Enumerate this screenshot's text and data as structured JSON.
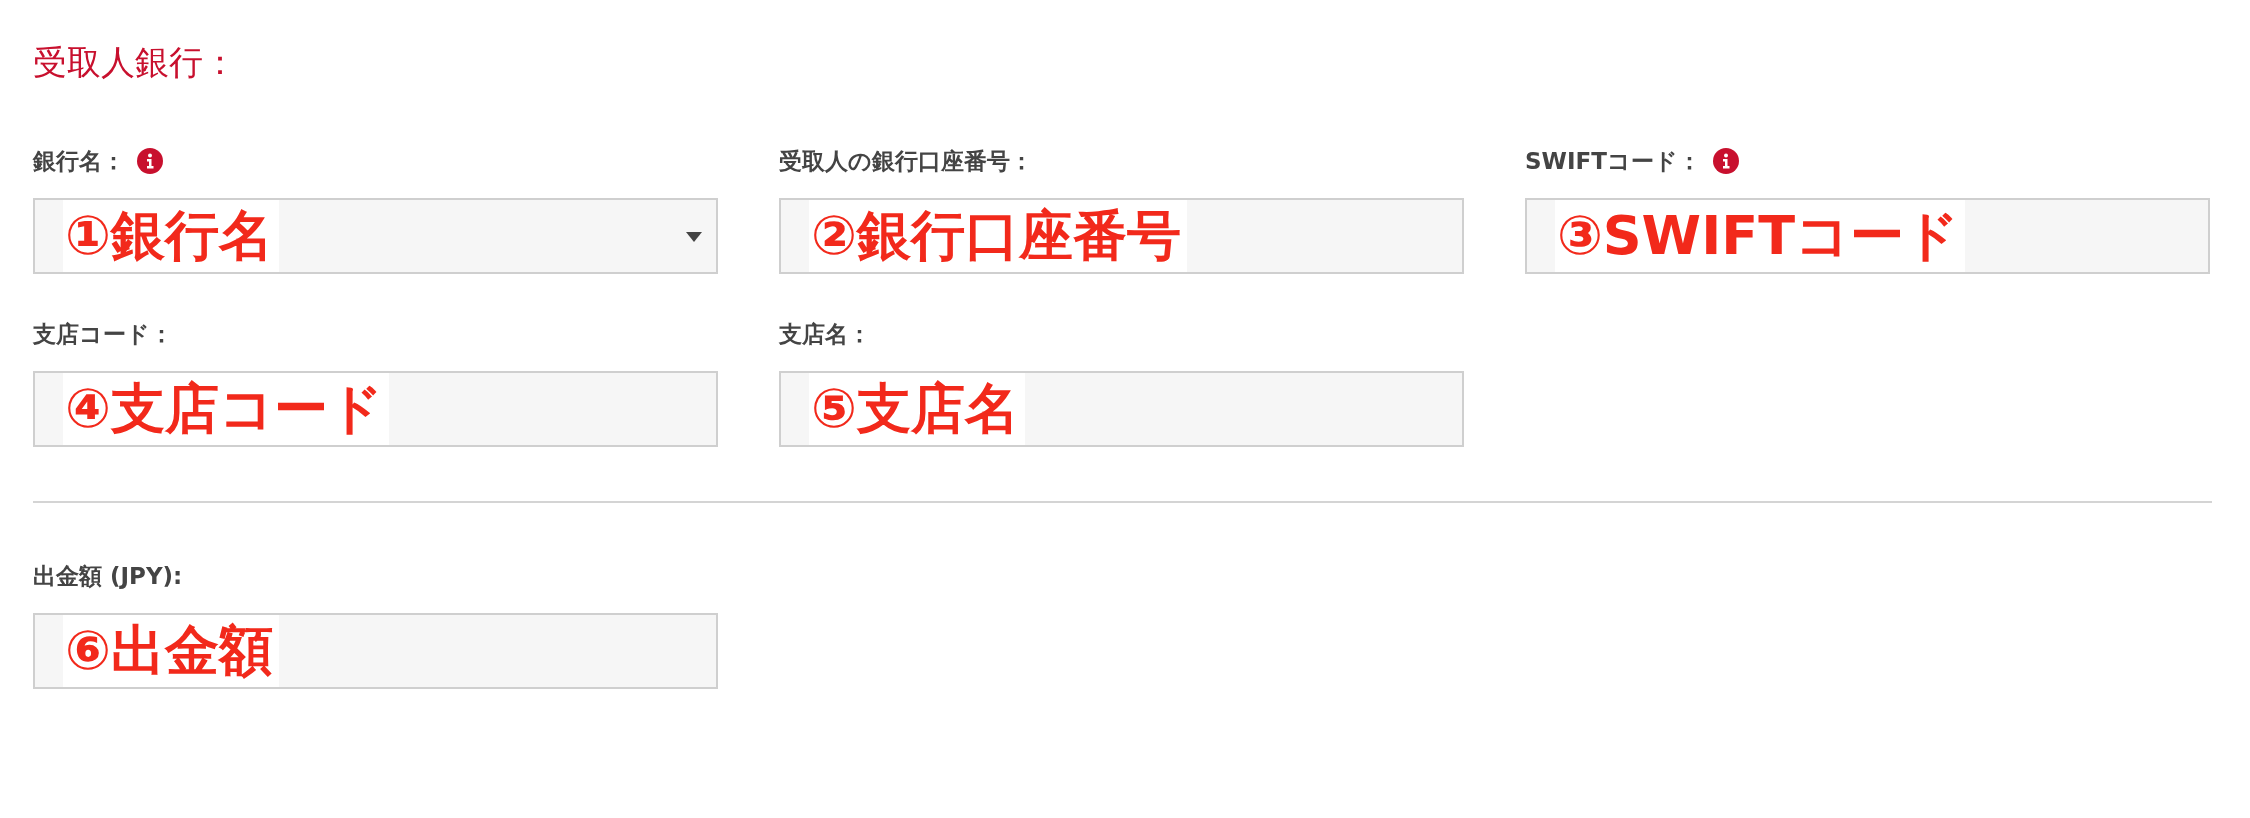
{
  "section_title": "受取人銀行：",
  "field_rows": [
    {
      "fields": [
        {
          "label": "銀行名：",
          "info": true,
          "kind": "select",
          "annotation": "①銀行名"
        },
        {
          "label": "受取人の銀行口座番号：",
          "info": false,
          "kind": "text",
          "annotation": "②銀行口座番号"
        },
        {
          "label": "SWIFTコード：",
          "info": true,
          "kind": "text",
          "annotation": "③SWIFTコード"
        }
      ]
    },
    {
      "fields": [
        {
          "label": "支店コード：",
          "info": false,
          "kind": "text",
          "annotation": "④支店コード"
        },
        {
          "label": "支店名：",
          "info": false,
          "kind": "text",
          "annotation": "⑤支店名"
        }
      ]
    }
  ],
  "amount_field": {
    "label": "出金額 (JPY):",
    "info": false,
    "kind": "text",
    "annotation": "⑥出金額"
  }
}
